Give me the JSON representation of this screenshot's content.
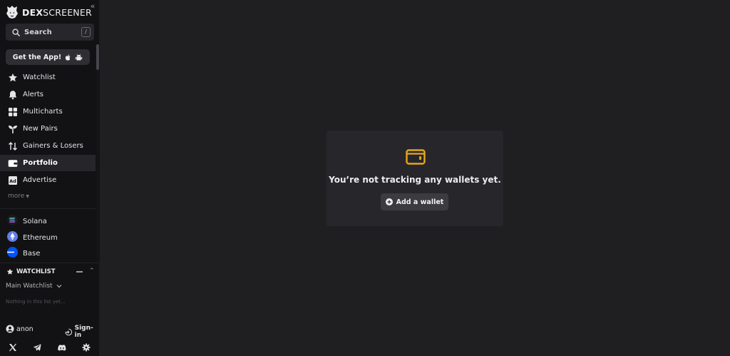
{
  "brand": {
    "name_bold": "DEX",
    "name_rest": "SCREENER"
  },
  "sidebar": {
    "collapse_glyph": "«",
    "search": {
      "label": "Search",
      "shortcut": "/"
    },
    "get_app": {
      "label": "Get the App!"
    },
    "nav_items": [
      {
        "label": "Watchlist",
        "icon": "star-icon"
      },
      {
        "label": "Alerts",
        "icon": "bell-icon"
      },
      {
        "label": "Multicharts",
        "icon": "grid-icon"
      },
      {
        "label": "New Pairs",
        "icon": "sprout-icon"
      },
      {
        "label": "Gainers & Losers",
        "icon": "arrows-updown-icon"
      },
      {
        "label": "Portfolio",
        "icon": "wallet-icon",
        "active": true
      },
      {
        "label": "Advertise",
        "icon": "ad-icon"
      }
    ],
    "more_label": "more",
    "chains": [
      {
        "label": "Solana",
        "icon": "solana-icon"
      },
      {
        "label": "Ethereum",
        "icon": "ethereum-icon"
      },
      {
        "label": "Base",
        "icon": "base-icon"
      }
    ],
    "watchlist": {
      "title": "WATCHLIST",
      "list_name": "Main Watchlist",
      "empty_text": "Nothing in this list yet..."
    },
    "user": {
      "name": "anon",
      "signin_label": "Sign-in"
    },
    "socials": [
      "x-icon",
      "telegram-icon",
      "discord-icon",
      "settings-icon"
    ]
  },
  "main": {
    "empty_message": "You’re not tracking any wallets yet.",
    "add_wallet_label": "Add a wallet"
  },
  "colors": {
    "accent": "#e6a51c",
    "sidebar_bg": "#121214",
    "main_bg": "#1f1f22",
    "panel_bg": "#27272b"
  }
}
